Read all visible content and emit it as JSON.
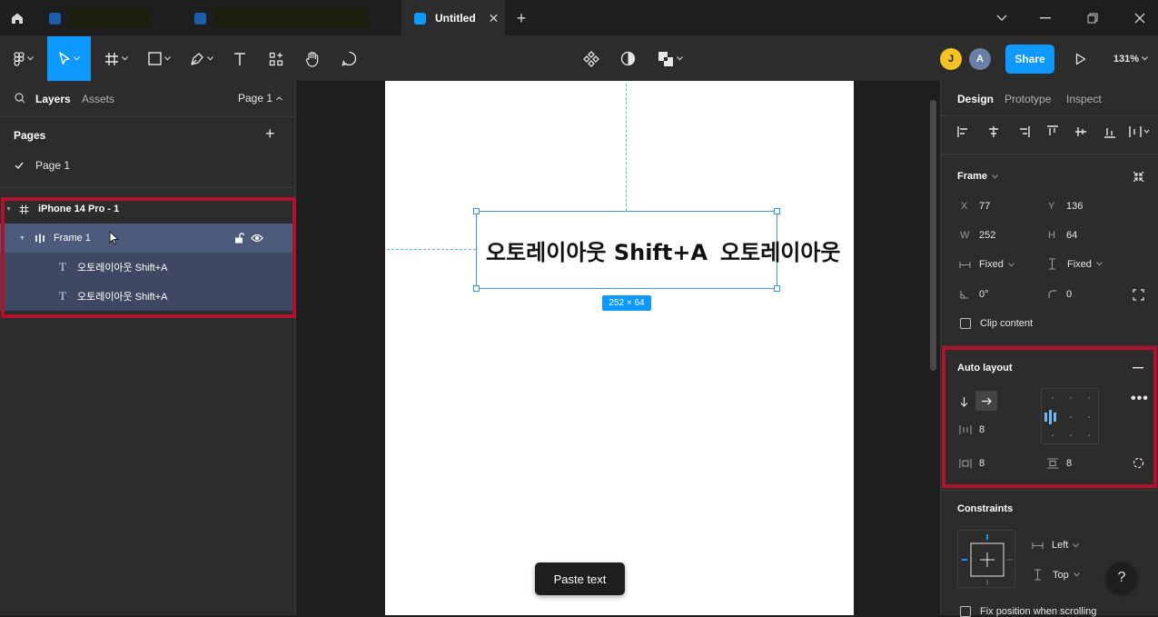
{
  "tabs": [
    {
      "title": "",
      "redacted": true
    },
    {
      "title": "",
      "redacted": true
    },
    {
      "title": "Untitled",
      "active": true
    }
  ],
  "toolbar": {
    "share_label": "Share",
    "zoom_label": "131%",
    "avatar1": "J",
    "avatar2": "A"
  },
  "left_panel": {
    "tab_layers": "Layers",
    "tab_assets": "Assets",
    "page_selector": "Page 1",
    "pages_title": "Pages",
    "pages": [
      "Page 1"
    ],
    "layers": [
      {
        "label": "iPhone 14 Pro - 1",
        "depth": 0,
        "kind": "frame"
      },
      {
        "label": "Frame 1",
        "depth": 1,
        "kind": "autolayout"
      },
      {
        "label": "오토레이아웃 Shift+A",
        "depth": 2,
        "kind": "text"
      },
      {
        "label": "오토레이아웃 Shift+A",
        "depth": 2,
        "kind": "text"
      }
    ]
  },
  "canvas": {
    "text1": "오토레이아웃 Shift+A",
    "text2": "오토레이아웃",
    "size_badge": "252 × 64",
    "paste_toast": "Paste text"
  },
  "right_panel": {
    "tab_design": "Design",
    "tab_prototype": "Prototype",
    "tab_inspect": "Inspect",
    "frame_title": "Frame",
    "x_label": "X",
    "x_value": "77",
    "y_label": "Y",
    "y_value": "136",
    "w_label": "W",
    "w_value": "252",
    "h_label": "H",
    "h_value": "64",
    "w_mode": "Fixed",
    "h_mode": "Fixed",
    "rotation": "0°",
    "radius": "0",
    "clip_label": "Clip content",
    "autolayout_title": "Auto layout",
    "spacing": "8",
    "padding_h": "8",
    "padding_v": "8",
    "constraints_title": "Constraints",
    "constraint_h": "Left",
    "constraint_v": "Top",
    "fix_position_label": "Fix position when scrolling",
    "help": "?"
  },
  "colors": {
    "accent": "#0d99ff",
    "highlight_box": "#b0112d",
    "selection_row": "#4c5a7c"
  }
}
